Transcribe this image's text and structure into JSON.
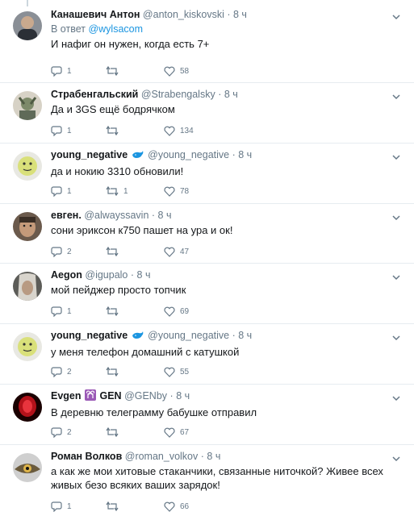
{
  "tweets": [
    {
      "name": "Канашевич Антон",
      "handle": "@anton_kiskovski",
      "sep": "·",
      "time": "8 ч",
      "reply_prefix": "В ответ",
      "reply_handle": "@wylsacom",
      "text": "И нафиг он нужен, когда есть 7+",
      "replies": "1",
      "retweets": "",
      "likes": "58"
    },
    {
      "name": "Страбенгальский",
      "handle": "@Strabengalsky",
      "sep": "·",
      "time": "8 ч",
      "text": "Да и 3GS ещё бодрячком",
      "replies": "1",
      "retweets": "",
      "likes": "134"
    },
    {
      "name": "young_negative",
      "handle": "@young_negative",
      "sep": "·",
      "time": "8 ч",
      "text": "да и нокию 3310 обновили!",
      "replies": "1",
      "retweets": "1",
      "likes": "78"
    },
    {
      "name": "евген.",
      "handle": "@alwayssavin",
      "sep": "·",
      "time": "8 ч",
      "text": "сони эриксон к750 пашет на ура и ок!",
      "replies": "2",
      "retweets": "",
      "likes": "47"
    },
    {
      "name": "Aegon",
      "handle": "@igupalo",
      "sep": "·",
      "time": "8 ч",
      "text": "мой пейджер просто топчик",
      "replies": "1",
      "retweets": "",
      "likes": "69"
    },
    {
      "name": "young_negative",
      "handle": "@young_negative",
      "sep": "·",
      "time": "8 ч",
      "text": "у меня телефон домашний с катушкой",
      "replies": "2",
      "retweets": "",
      "likes": "55"
    },
    {
      "name_part1": "Evgen",
      "name_part2": "GEN",
      "handle": "@GENby",
      "sep": "·",
      "time": "8 ч",
      "text": "В деревню телеграмму бабушке отправил",
      "replies": "2",
      "retweets": "",
      "likes": "67"
    },
    {
      "name": "Роман Волков",
      "handle": "@roman_volkov",
      "sep": "·",
      "time": "8 ч",
      "text": "а как же мои хитовые стаканчики, связанные ниточкой? Живее всех живых безо всяких ваших зарядок!",
      "replies": "1",
      "retweets": "",
      "likes": "66"
    }
  ],
  "icons": {
    "reply": "reply-icon",
    "retweet": "retweet-icon",
    "like": "heart-icon",
    "more": "chevron-down-icon",
    "verified_badge": "whale-icon",
    "aries_badge": "aries-icon"
  },
  "colors": {
    "text": "#14171a",
    "secondary": "#657786",
    "link": "#1b95e0",
    "divider": "#e6ecf0",
    "aries": "#9b59b6"
  }
}
